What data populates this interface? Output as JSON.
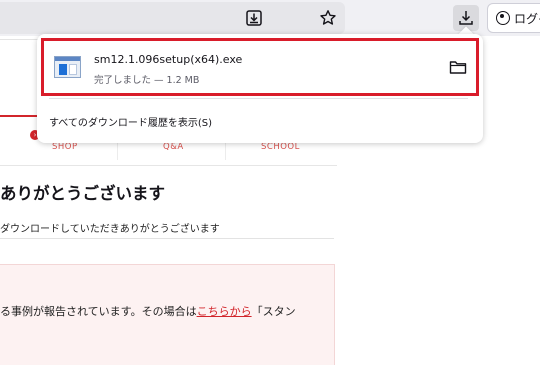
{
  "toolbar": {
    "icons": [
      "page-download-icon",
      "star-icon",
      "download-icon",
      "account-icon"
    ],
    "login_label": "ログイ"
  },
  "page": {
    "nav": [
      "SHOP",
      "Q&A",
      "SCHOOL"
    ],
    "nav_badge": "›",
    "heading": "ありがとうございます",
    "subtext": "ダウンロードしていただきありがとうございます",
    "notice_before": "る事例が報告されています。その場合は",
    "notice_link": "こちらから",
    "notice_after": "「スタン"
  },
  "downloads_panel": {
    "item": {
      "file_name": "sm12.1.096setup(x64).exe",
      "status": "完了しました — 1.2 MB",
      "icon": "exe-file-icon",
      "action_icon": "folder-icon"
    },
    "show_all_label": "すべてのダウンロード履歴を表示(S)"
  },
  "colors": {
    "highlight_border": "#d91c2a",
    "brand_red": "#d2252b",
    "toolbar_bg": "#f0f0f4"
  }
}
